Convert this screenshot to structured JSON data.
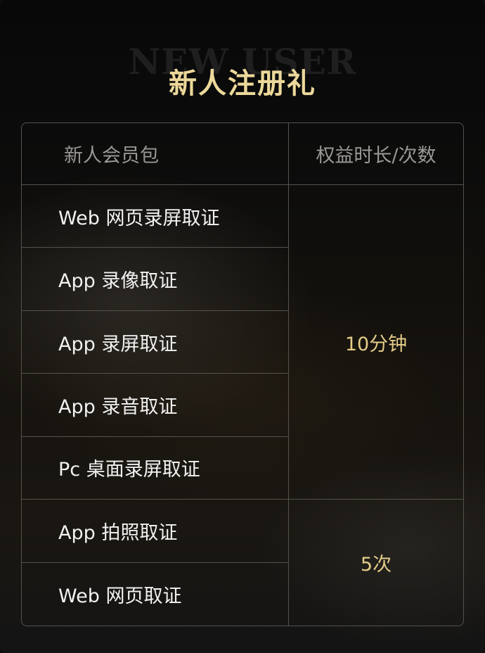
{
  "header": {
    "watermark": "NEW USER",
    "title": "新人注册礼"
  },
  "table": {
    "columns": [
      "新人会员包",
      "权益时长/次数"
    ],
    "items": [
      "Web 网页录屏取证",
      "App 录像取证",
      "App 录屏取证",
      "App 录音取证",
      "Pc 桌面录屏取证",
      "App 拍照取证",
      "Web 网页取证"
    ],
    "groups": [
      {
        "value": "10分钟",
        "rows": 5
      },
      {
        "value": "5次",
        "rows": 2
      }
    ]
  },
  "colors": {
    "title": "#ecd89a",
    "value": "#e3cc88",
    "border": "#55524c",
    "background": "#0e0e0e"
  }
}
